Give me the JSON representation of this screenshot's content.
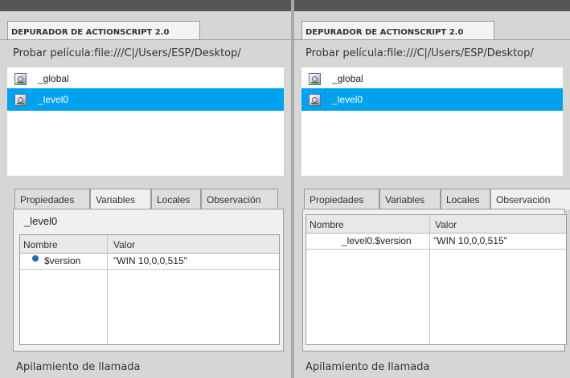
{
  "left_panel": {
    "panel_title": "DEPURADOR DE ACTIONSCRIPT 2.0",
    "movie_path": "Probar película:file:///C|/Users/ESP/Desktop/",
    "movie_items": [
      {
        "label": "_global",
        "selected": false
      },
      {
        "label": "_level0",
        "selected": true
      }
    ],
    "tabs": [
      "Propiedades",
      "Variables",
      "Locales",
      "Observación"
    ],
    "active_tab": "Variables",
    "scope_label": "_level0",
    "grid": {
      "columns": [
        "Nombre",
        "Valor"
      ],
      "rows": [
        {
          "name": "$version",
          "value": "\"WIN 10,0,0,515\""
        }
      ]
    },
    "call_stack_label": "Apilamiento de llamada"
  },
  "right_panel": {
    "panel_title": "DEPURADOR DE ACTIONSCRIPT 2.0",
    "movie_path": "Probar película:file:///C|/Users/ESP/Desktop/",
    "movie_items": [
      {
        "label": "_global",
        "selected": false
      },
      {
        "label": "_level0",
        "selected": true
      }
    ],
    "tabs": [
      "Propiedades",
      "Variables",
      "Locales",
      "Observación"
    ],
    "active_tab": "Observación",
    "grid": {
      "columns": [
        "Nombre",
        "Valor"
      ],
      "rows": [
        {
          "name": "_level0.$version",
          "value": "\"WIN 10,0,0,515\""
        }
      ]
    },
    "call_stack_label": "Apilamiento de llamada"
  },
  "colors": {
    "selection": "#00a2f0",
    "panel_background": "#d6d6d6",
    "variable_dot": "#1f6fb5"
  },
  "icons": {
    "movie_clip": "movie-clip-icon",
    "variable": "variable-dot-icon"
  }
}
